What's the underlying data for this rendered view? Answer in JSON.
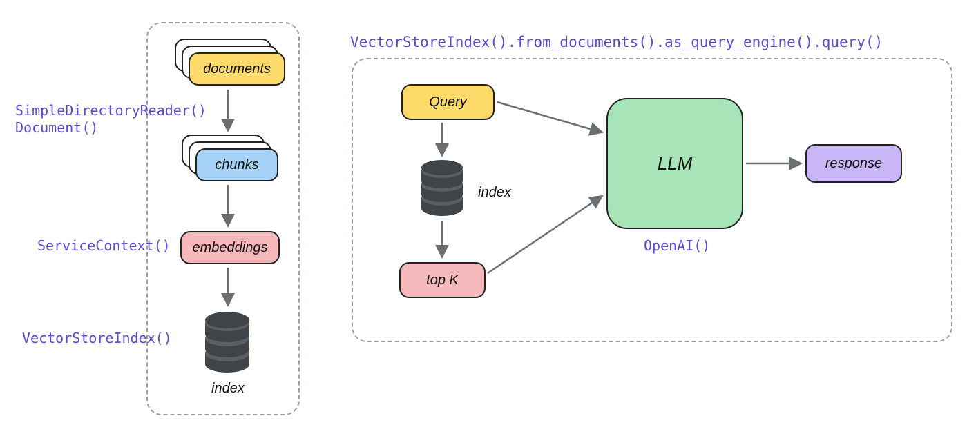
{
  "left_panel": {
    "documents_label": "documents",
    "chunks_label": "chunks",
    "embeddings_label": "embeddings",
    "index_label": "index",
    "code_labels": {
      "reader": "SimpleDirectoryReader()\nDocument()",
      "service_context": "ServiceContext()",
      "vector_store_index": "VectorStoreIndex()"
    }
  },
  "right_panel": {
    "title": "VectorStoreIndex().from_documents().as_query_engine().query()",
    "query_label": "Query",
    "index_label": "index",
    "topk_label": "top K",
    "llm_label": "LLM",
    "response_label": "response",
    "openai_label": "OpenAI()"
  },
  "colors": {
    "yellow": "#fdda6a",
    "blue": "#a6d2f7",
    "pink": "#f6b9bb",
    "green": "#a7e4b8",
    "purple": "#c8b6f7",
    "code_purple": "#5b4cd6",
    "border": "#222",
    "dash": "#9aa0a6",
    "disk": "#3f4448"
  }
}
